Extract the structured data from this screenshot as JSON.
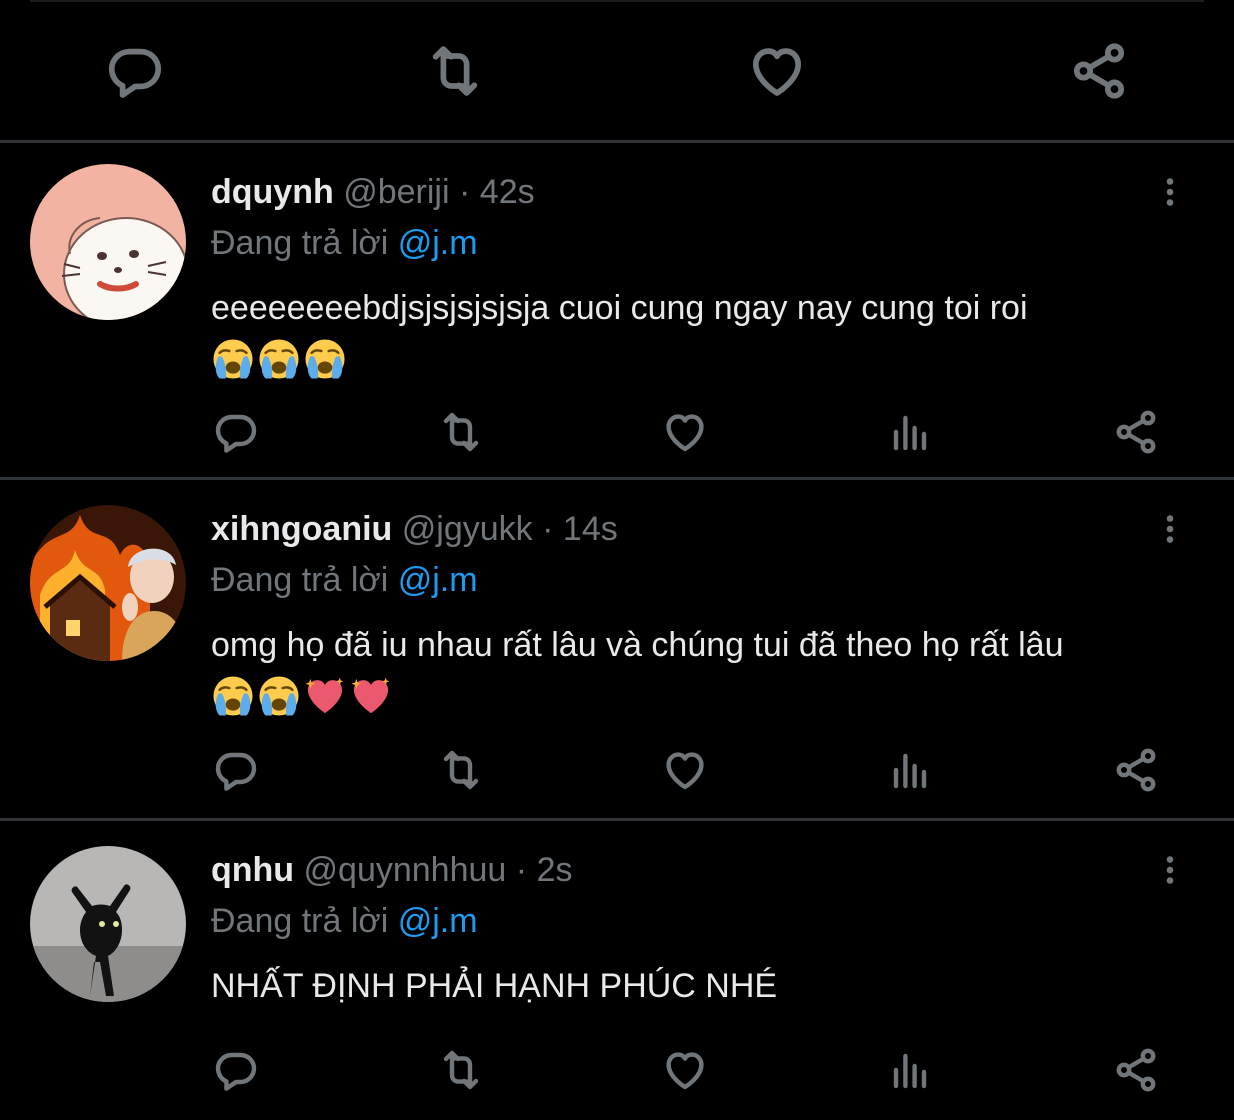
{
  "top_actions": {
    "icons": [
      "reply-icon",
      "retweet-icon",
      "like-icon",
      "share-icon"
    ]
  },
  "tweets": [
    {
      "name": "dquynh",
      "handle": "@beriji",
      "separator": "·",
      "time": "42s",
      "reply_prefix": "Đang trả lời",
      "reply_to": "@j.m",
      "text": "eeeeeeeebdjsjsjsjsjsja cuoi cung ngay nay cung toi roi",
      "emojis": [
        "loudly-crying-face",
        "loudly-crying-face",
        "loudly-crying-face"
      ],
      "avatar": "cartoon-seal-avatar"
    },
    {
      "name": "xihngoaniu",
      "handle": "@jgyukk",
      "separator": "·",
      "time": "14s",
      "reply_prefix": "Đang trả lời",
      "reply_to": "@j.m",
      "text": "omg họ đã iu nhau rất lâu và chúng tui đã theo họ rất lâu",
      "emojis": [
        "loudly-crying-face",
        "loudly-crying-face",
        "sparkling-heart",
        "sparkling-heart"
      ],
      "avatar": "burning-house-person-avatar"
    },
    {
      "name": "qnhu",
      "handle": "@quynnhhuu",
      "separator": "·",
      "time": "2s",
      "reply_prefix": "Đang trả lời",
      "reply_to": "@j.m",
      "text": "NHẤT ĐỊNH PHẢI HẠNH PHÚC NHÉ",
      "emojis": [],
      "avatar": "black-cat-avatar"
    }
  ],
  "tweet_action_icons": [
    "reply-icon",
    "retweet-icon",
    "like-icon",
    "analytics-icon",
    "share-icon"
  ],
  "colors": {
    "background": "#000000",
    "text": "#e7e9ea",
    "secondary": "#71767b",
    "accent": "#1d9bf0",
    "divider": "#2f3336"
  }
}
